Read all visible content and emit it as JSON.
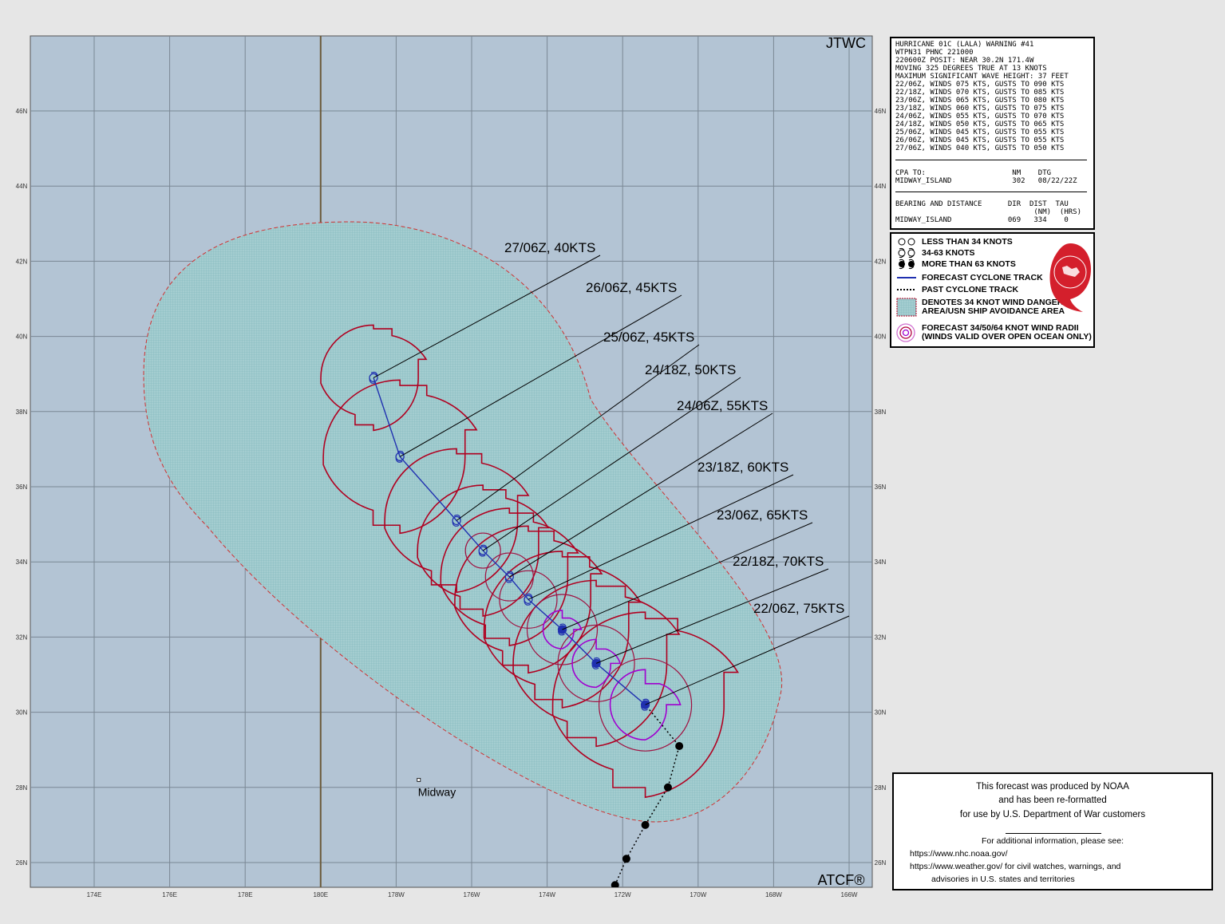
{
  "map": {
    "header_mark": "JTWC",
    "footer_mark": "ATCF®",
    "lon_labels": [
      "174E",
      "176E",
      "178E",
      "180E",
      "178W",
      "176W",
      "174W",
      "172W",
      "170W",
      "168W",
      "166W"
    ],
    "lat_labels": [
      "46N",
      "44N",
      "42N",
      "40N",
      "38N",
      "36N",
      "34N",
      "32N",
      "30N",
      "28N",
      "26N"
    ],
    "place_label": "Midway",
    "forecast_labels": [
      {
        "text": "27/06Z, 40KTS",
        "lat": 38.9,
        "lon": -178.6
      },
      {
        "text": "26/06Z, 45KTS",
        "lat": 36.8,
        "lon": -177.9
      },
      {
        "text": "25/06Z, 45KTS",
        "lat": 35.1,
        "lon": -176.4
      },
      {
        "text": "24/18Z, 50KTS",
        "lat": 34.3,
        "lon": -175.7
      },
      {
        "text": "24/06Z, 55KTS",
        "lat": 33.6,
        "lon": -175.0
      },
      {
        "text": "23/18Z, 60KTS",
        "lat": 33.0,
        "lon": -174.5
      },
      {
        "text": "23/06Z, 65KTS",
        "lat": 32.2,
        "lon": -173.6
      },
      {
        "text": "22/18Z, 70KTS",
        "lat": 31.3,
        "lon": -172.7
      },
      {
        "text": "22/06Z, 75KTS",
        "lat": 30.2,
        "lon": -171.4
      }
    ],
    "past_track": [
      {
        "lat": 25.4,
        "lon": -172.2
      },
      {
        "lat": 26.1,
        "lon": -171.9
      },
      {
        "lat": 27.0,
        "lon": -171.4
      },
      {
        "lat": 28.0,
        "lon": -170.8
      },
      {
        "lat": 29.1,
        "lon": -170.5
      },
      {
        "lat": 30.2,
        "lon": -171.4
      }
    ],
    "midway": {
      "lat": 28.2,
      "lon": -177.4
    },
    "colors": {
      "ocean": "#b3c4d4",
      "danger_fill": "#a6cfd0",
      "wind34": "#b00020",
      "wind50": "#a01040",
      "wind64": "#a000d0",
      "track": "#2030b0",
      "dateline": "#6b5a3a"
    }
  },
  "warning": {
    "lines": [
      "HURRICANE 01C (LALA) WARNING #41",
      "WTPN31 PHNC 221000",
      "220600Z POSIT: NEAR 30.2N 171.4W",
      "MOVING 325 DEGREES TRUE AT 13 KNOTS",
      "MAXIMUM SIGNIFICANT WAVE HEIGHT: 37 FEET",
      "22/06Z, WINDS 075 KTS, GUSTS TO 090 KTS",
      "22/18Z, WINDS 070 KTS, GUSTS TO 085 KTS",
      "23/06Z, WINDS 065 KTS, GUSTS TO 080 KTS",
      "23/18Z, WINDS 060 KTS, GUSTS TO 075 KTS",
      "24/06Z, WINDS 055 KTS, GUSTS TO 070 KTS",
      "24/18Z, WINDS 050 KTS, GUSTS TO 065 KTS",
      "25/06Z, WINDS 045 KTS, GUSTS TO 055 KTS",
      "26/06Z, WINDS 045 KTS, GUSTS TO 055 KTS",
      "27/06Z, WINDS 040 KTS, GUSTS TO 050 KTS"
    ],
    "cpa_header": "CPA TO:                    NM    DTG",
    "cpa_row": "MIDWAY_ISLAND              302   08/22/22Z",
    "bearing_header": "BEARING AND DISTANCE      DIR  DIST  TAU",
    "bearing_units": "                                (NM)  (HRS)",
    "bearing_row": "MIDWAY_ISLAND             069   334    0"
  },
  "legend": {
    "items": [
      "LESS THAN 34 KNOTS",
      "34-63 KNOTS",
      "MORE THAN 63 KNOTS",
      "FORECAST CYCLONE TRACK",
      "PAST CYCLONE TRACK",
      "DENOTES 34 KNOT WIND DANGER",
      "AREA/USN SHIP AVOIDANCE AREA",
      "FORECAST 34/50/64 KNOT WIND RADII",
      "(WINDS VALID OVER OPEN OCEAN ONLY)"
    ],
    "logo_text": "CENTRAL PACIFIC HURRICANE CENTER"
  },
  "credit": {
    "line1": "This forecast was produced by NOAA",
    "line2": "and has been re-formatted",
    "line3": "for use by U.S. Department of War customers",
    "line4": "For additional information, please see:",
    "line5": "https://www.nhc.noaa.gov/",
    "line6": "https://www.weather.gov/ for civil watches, warnings, and",
    "line7": "advisories in U.S. states and territories"
  }
}
